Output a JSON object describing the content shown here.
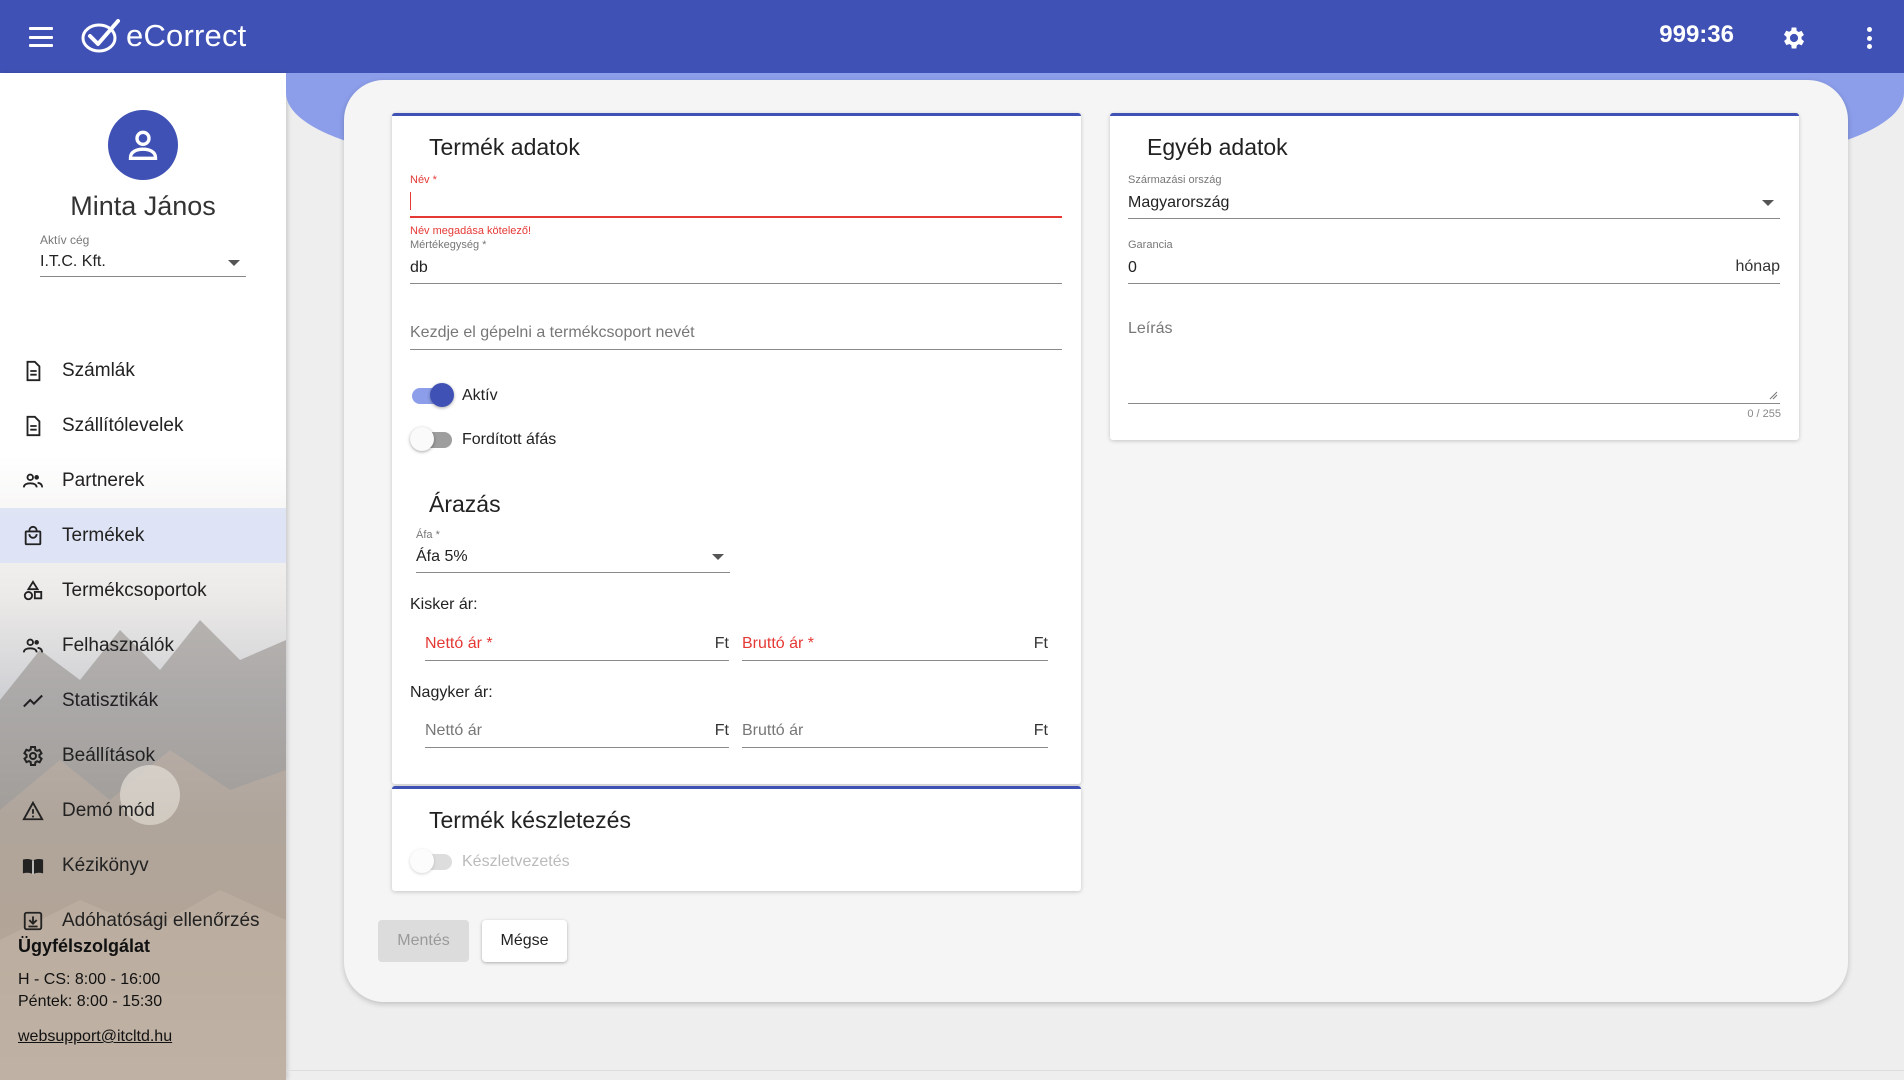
{
  "app": {
    "brand": "eCorrect",
    "timer": "999:36",
    "colors": {
      "primary": "#3f51b5",
      "error": "#e53935"
    }
  },
  "user": {
    "name": "Minta János",
    "company_label": "Aktív cég",
    "company_value": "I.T.C. Kft."
  },
  "sidebar": {
    "items": [
      {
        "label": "Számlák",
        "icon": "document-icon"
      },
      {
        "label": "Szállítólevelek",
        "icon": "document-icon"
      },
      {
        "label": "Partnerek",
        "icon": "people-icon"
      },
      {
        "label": "Termékek",
        "icon": "shopping-bag-icon",
        "active": true
      },
      {
        "label": "Termékcsoportok",
        "icon": "shapes-icon"
      },
      {
        "label": "Felhasználók",
        "icon": "people-icon"
      },
      {
        "label": "Statisztikák",
        "icon": "trend-icon"
      },
      {
        "label": "Beállítások",
        "icon": "gear-icon"
      },
      {
        "label": "Demó mód",
        "icon": "warning-icon"
      },
      {
        "label": "Kézikönyv",
        "icon": "book-icon"
      },
      {
        "label": "Adóhatósági ellenőrzés",
        "icon": "download-box-icon"
      }
    ],
    "support": {
      "title": "Ügyfélszolgálat",
      "hours_1": "H - CS: 8:00 - 16:00",
      "hours_2": "Péntek: 8:00 - 15:30",
      "email": "websupport@itcltd.hu"
    }
  },
  "product": {
    "title": "Termék adatok",
    "name_label": "Név *",
    "name_error": "Név megadása kötelező!",
    "unit_label": "Mértékegység *",
    "unit_value": "db",
    "group_placeholder": "Kezdje el gépelni a termékcsoport nevét",
    "active_label": "Aktív",
    "active_on": true,
    "reverse_vat_label": "Fordított áfás",
    "reverse_vat_on": false
  },
  "pricing": {
    "title": "Árazás",
    "vat_label": "Áfa *",
    "vat_value": "Áfa 5%",
    "retail_label": "Kisker ár:",
    "retail_net_placeholder": "Nettó ár *",
    "retail_gross_placeholder": "Bruttó ár *",
    "wholesale_label": "Nagyker ár:",
    "wholesale_net_placeholder": "Nettó ár",
    "wholesale_gross_placeholder": "Bruttó ár",
    "currency": "Ft"
  },
  "stock": {
    "title": "Termék készletezés",
    "toggle_label": "Készletvezetés",
    "enabled": false
  },
  "other": {
    "title": "Egyéb adatok",
    "origin_label": "Származási ország",
    "origin_value": "Magyarország",
    "warranty_label": "Garancia",
    "warranty_value": "0",
    "warranty_unit": "hónap",
    "description_placeholder": "Leírás",
    "counter": "0 / 255"
  },
  "actions": {
    "save_label": "Mentés",
    "cancel_label": "Mégse"
  }
}
